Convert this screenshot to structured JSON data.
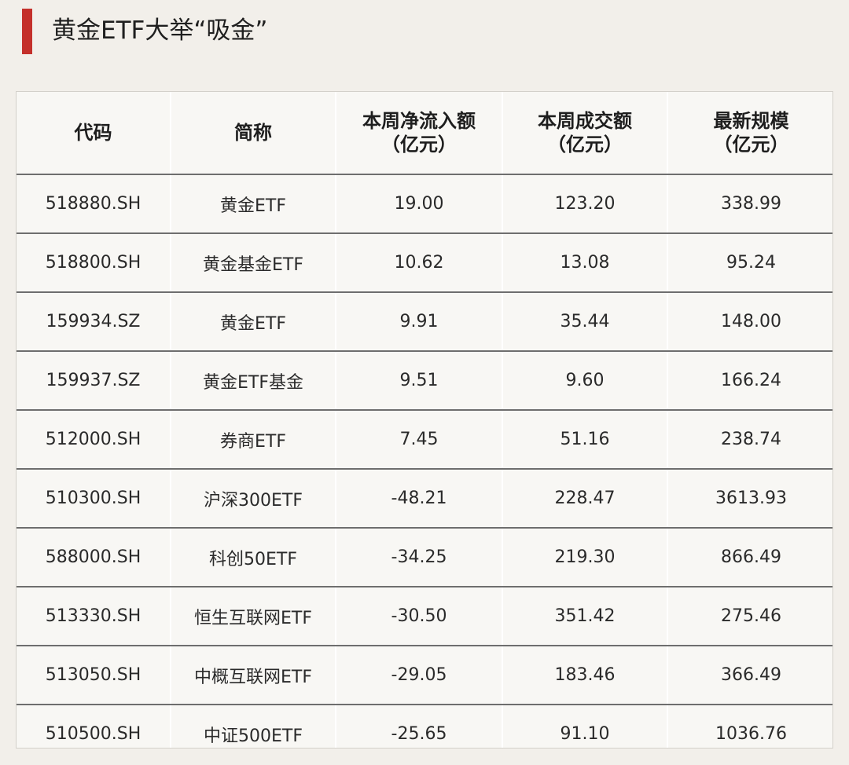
{
  "header": {
    "title": "黄金ETF大举“吸金”",
    "accent_color": "#c4302b"
  },
  "table": {
    "columns": [
      {
        "line1": "代码",
        "line2": ""
      },
      {
        "line1": "简称",
        "line2": ""
      },
      {
        "line1": "本周净流入额",
        "line2": "（亿元）"
      },
      {
        "line1": "本周成交额",
        "line2": "（亿元）"
      },
      {
        "line1": "最新规模",
        "line2": "（亿元）"
      }
    ],
    "rows": [
      [
        "518880.SH",
        "黄金ETF",
        "19.00",
        "123.20",
        "338.99"
      ],
      [
        "518800.SH",
        "黄金基金ETF",
        "10.62",
        "13.08",
        "95.24"
      ],
      [
        "159934.SZ",
        "黄金ETF",
        "9.91",
        "35.44",
        "148.00"
      ],
      [
        "159937.SZ",
        "黄金ETF基金",
        "9.51",
        "9.60",
        "166.24"
      ],
      [
        "512000.SH",
        "券商ETF",
        "7.45",
        "51.16",
        "238.74"
      ],
      [
        "510300.SH",
        "沪深300ETF",
        "-48.21",
        "228.47",
        "3613.93"
      ],
      [
        "588000.SH",
        "科创50ETF",
        "-34.25",
        "219.30",
        "866.49"
      ],
      [
        "513330.SH",
        "恒生互联网ETF",
        "-30.50",
        "351.42",
        "275.46"
      ],
      [
        "513050.SH",
        "中概互联网ETF",
        "-29.05",
        "183.46",
        "366.49"
      ],
      [
        "510500.SH",
        "中证500ETF",
        "-25.65",
        "91.10",
        "1036.76"
      ]
    ]
  }
}
